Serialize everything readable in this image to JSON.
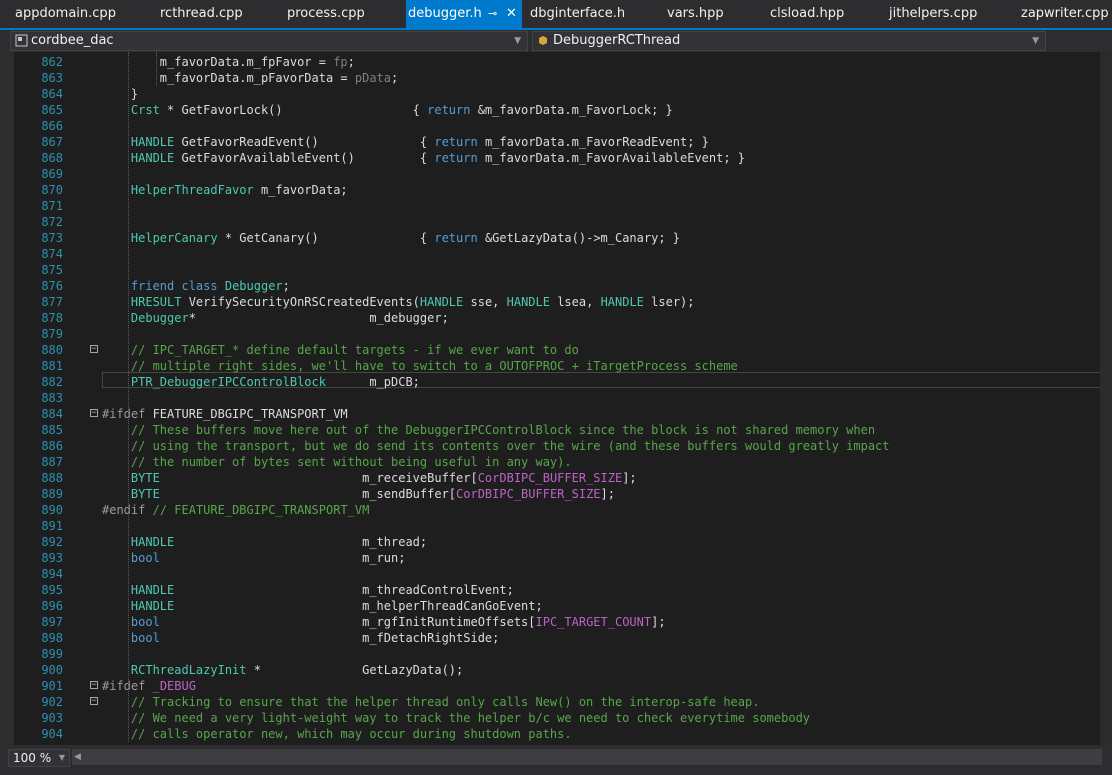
{
  "tabs": [
    {
      "label": "appdomain.cpp",
      "active": false
    },
    {
      "label": "rcthread.cpp",
      "active": false
    },
    {
      "label": "process.cpp",
      "active": false
    },
    {
      "label": "debugger.h",
      "active": true
    },
    {
      "label": "dbginterface.h",
      "active": false
    },
    {
      "label": "vars.hpp",
      "active": false
    },
    {
      "label": "clsload.hpp",
      "active": false
    },
    {
      "label": "jithelpers.cpp",
      "active": false
    },
    {
      "label": "zapwriter.cpp",
      "active": false
    }
  ],
  "tab_icons": {
    "pin": "pin-icon",
    "close": "close-icon"
  },
  "navbar": {
    "project": "cordbee_dac",
    "member": "DebuggerRCThread"
  },
  "status": {
    "zoom": "100 %"
  },
  "colors": {
    "accent": "#007acc",
    "keyword": "#569cd6",
    "type": "#4ec9b0",
    "comment": "#57a64a",
    "line_number": "#2b91af",
    "macro": "#bd63c5"
  },
  "code_lines": [
    {
      "n": "862",
      "segs": [
        [
          "",
          "        m_favorData.m_fpFavor = "
        ],
        [
          "par",
          "fp"
        ],
        [
          "",
          ";"
        ]
      ]
    },
    {
      "n": "863",
      "segs": [
        [
          "",
          "        m_favorData.m_pFavorData = "
        ],
        [
          "par",
          "pData"
        ],
        [
          "",
          ";"
        ]
      ]
    },
    {
      "n": "864",
      "segs": [
        [
          "",
          "    }"
        ]
      ]
    },
    {
      "n": "865",
      "segs": [
        [
          "",
          "    "
        ],
        [
          "ty",
          "Crst"
        ],
        [
          "",
          " * GetFavorLock()                  { "
        ],
        [
          "kw",
          "return"
        ],
        [
          "",
          " &m_favorData.m_FavorLock; }"
        ]
      ]
    },
    {
      "n": "866",
      "segs": []
    },
    {
      "n": "867",
      "segs": [
        [
          "",
          "    "
        ],
        [
          "ty",
          "HANDLE"
        ],
        [
          "",
          " GetFavorReadEvent()              { "
        ],
        [
          "kw",
          "return"
        ],
        [
          "",
          " m_favorData.m_FavorReadEvent; }"
        ]
      ]
    },
    {
      "n": "868",
      "segs": [
        [
          "",
          "    "
        ],
        [
          "ty",
          "HANDLE"
        ],
        [
          "",
          " GetFavorAvailableEvent()         { "
        ],
        [
          "kw",
          "return"
        ],
        [
          "",
          " m_favorData.m_FavorAvailableEvent; }"
        ]
      ]
    },
    {
      "n": "869",
      "segs": []
    },
    {
      "n": "870",
      "segs": [
        [
          "",
          "    "
        ],
        [
          "ty",
          "HelperThreadFavor"
        ],
        [
          "",
          " m_favorData;"
        ]
      ]
    },
    {
      "n": "871",
      "segs": []
    },
    {
      "n": "872",
      "segs": []
    },
    {
      "n": "873",
      "segs": [
        [
          "",
          "    "
        ],
        [
          "ty",
          "HelperCanary"
        ],
        [
          "",
          " * GetCanary()              { "
        ],
        [
          "kw",
          "return"
        ],
        [
          "",
          " &GetLazyData()->m_Canary; }"
        ]
      ]
    },
    {
      "n": "874",
      "segs": []
    },
    {
      "n": "875",
      "segs": []
    },
    {
      "n": "876",
      "segs": [
        [
          "",
          "    "
        ],
        [
          "kw",
          "friend class"
        ],
        [
          "",
          " "
        ],
        [
          "ty",
          "Debugger"
        ],
        [
          "",
          ";"
        ]
      ]
    },
    {
      "n": "877",
      "segs": [
        [
          "",
          "    "
        ],
        [
          "ty",
          "HRESULT"
        ],
        [
          "",
          " VerifySecurityOnRSCreatedEvents("
        ],
        [
          "ty",
          "HANDLE"
        ],
        [
          "",
          " sse, "
        ],
        [
          "ty",
          "HANDLE"
        ],
        [
          "",
          " lsea, "
        ],
        [
          "ty",
          "HANDLE"
        ],
        [
          "",
          " lser);"
        ]
      ]
    },
    {
      "n": "878",
      "segs": [
        [
          "",
          "    "
        ],
        [
          "ty",
          "Debugger"
        ],
        [
          "",
          "*                        m_debugger;"
        ]
      ]
    },
    {
      "n": "879",
      "segs": []
    },
    {
      "n": "880",
      "fold": true,
      "segs": [
        [
          "",
          "    "
        ],
        [
          "cm",
          "// IPC_TARGET_* define default targets - if we ever want to do"
        ]
      ]
    },
    {
      "n": "881",
      "segs": [
        [
          "",
          "    "
        ],
        [
          "cm",
          "// multiple right sides, we'll have to switch to a OUTOFPROC + iTargetProcess scheme"
        ]
      ]
    },
    {
      "n": "882",
      "segs": [
        [
          "",
          "    "
        ],
        [
          "ty",
          "PTR_DebuggerIPCControlBlock"
        ],
        [
          "",
          "      m_pDCB;"
        ]
      ]
    },
    {
      "n": "883",
      "segs": []
    },
    {
      "n": "884",
      "fold": true,
      "segs": [
        [
          "pp",
          "#ifdef"
        ],
        [
          "",
          " FEATURE_DBGIPC_TRANSPORT_VM"
        ]
      ]
    },
    {
      "n": "885",
      "segs": [
        [
          "",
          "    "
        ],
        [
          "cm",
          "// These buffers move here out of the DebuggerIPCControlBlock since the block is not shared memory when"
        ]
      ]
    },
    {
      "n": "886",
      "segs": [
        [
          "",
          "    "
        ],
        [
          "cm",
          "// using the transport, but we do send its contents over the wire (and these buffers would greatly impact"
        ]
      ]
    },
    {
      "n": "887",
      "segs": [
        [
          "",
          "    "
        ],
        [
          "cm",
          "// the number of bytes sent without being useful in any way)."
        ]
      ]
    },
    {
      "n": "888",
      "segs": [
        [
          "",
          "    "
        ],
        [
          "ty",
          "BYTE"
        ],
        [
          "",
          "                            m_receiveBuffer["
        ],
        [
          "mac",
          "CorDBIPC_BUFFER_SIZE"
        ],
        [
          "",
          "];"
        ]
      ]
    },
    {
      "n": "889",
      "segs": [
        [
          "",
          "    "
        ],
        [
          "ty",
          "BYTE"
        ],
        [
          "",
          "                            m_sendBuffer["
        ],
        [
          "mac",
          "CorDBIPC_BUFFER_SIZE"
        ],
        [
          "",
          "];"
        ]
      ]
    },
    {
      "n": "890",
      "segs": [
        [
          "pp",
          "#endif"
        ],
        [
          "",
          " "
        ],
        [
          "cm",
          "// FEATURE_DBGIPC_TRANSPORT_VM"
        ]
      ]
    },
    {
      "n": "891",
      "segs": []
    },
    {
      "n": "892",
      "segs": [
        [
          "",
          "    "
        ],
        [
          "ty",
          "HANDLE"
        ],
        [
          "",
          "                          m_thread;"
        ]
      ]
    },
    {
      "n": "893",
      "segs": [
        [
          "",
          "    "
        ],
        [
          "kw",
          "bool"
        ],
        [
          "",
          "                            m_run;"
        ]
      ]
    },
    {
      "n": "894",
      "segs": []
    },
    {
      "n": "895",
      "segs": [
        [
          "",
          "    "
        ],
        [
          "ty",
          "HANDLE"
        ],
        [
          "",
          "                          m_threadControlEvent;"
        ]
      ]
    },
    {
      "n": "896",
      "segs": [
        [
          "",
          "    "
        ],
        [
          "ty",
          "HANDLE"
        ],
        [
          "",
          "                          m_helperThreadCanGoEvent;"
        ]
      ]
    },
    {
      "n": "897",
      "segs": [
        [
          "",
          "    "
        ],
        [
          "kw",
          "bool"
        ],
        [
          "",
          "                            m_rgfInitRuntimeOffsets["
        ],
        [
          "mac",
          "IPC_TARGET_COUNT"
        ],
        [
          "",
          "];"
        ]
      ]
    },
    {
      "n": "898",
      "segs": [
        [
          "",
          "    "
        ],
        [
          "kw",
          "bool"
        ],
        [
          "",
          "                            m_fDetachRightSide;"
        ]
      ]
    },
    {
      "n": "899",
      "segs": []
    },
    {
      "n": "900",
      "segs": [
        [
          "",
          "    "
        ],
        [
          "ty",
          "RCThreadLazyInit"
        ],
        [
          "",
          " *              GetLazyData();"
        ]
      ]
    },
    {
      "n": "901",
      "fold": true,
      "segs": [
        [
          "pp",
          "#ifdef"
        ],
        [
          "",
          " "
        ],
        [
          "mac",
          "_DEBUG"
        ]
      ]
    },
    {
      "n": "902",
      "fold": true,
      "segs": [
        [
          "",
          "    "
        ],
        [
          "cm",
          "// Tracking to ensure that the helper thread only calls New() on the interop-safe heap."
        ]
      ]
    },
    {
      "n": "903",
      "segs": [
        [
          "",
          "    "
        ],
        [
          "cm",
          "// We need a very light-weight way to track the helper b/c we need to check everytime somebody"
        ]
      ]
    },
    {
      "n": "904",
      "segs": [
        [
          "",
          "    "
        ],
        [
          "cm",
          "// calls operator new, which may occur during shutdown paths."
        ]
      ]
    }
  ]
}
